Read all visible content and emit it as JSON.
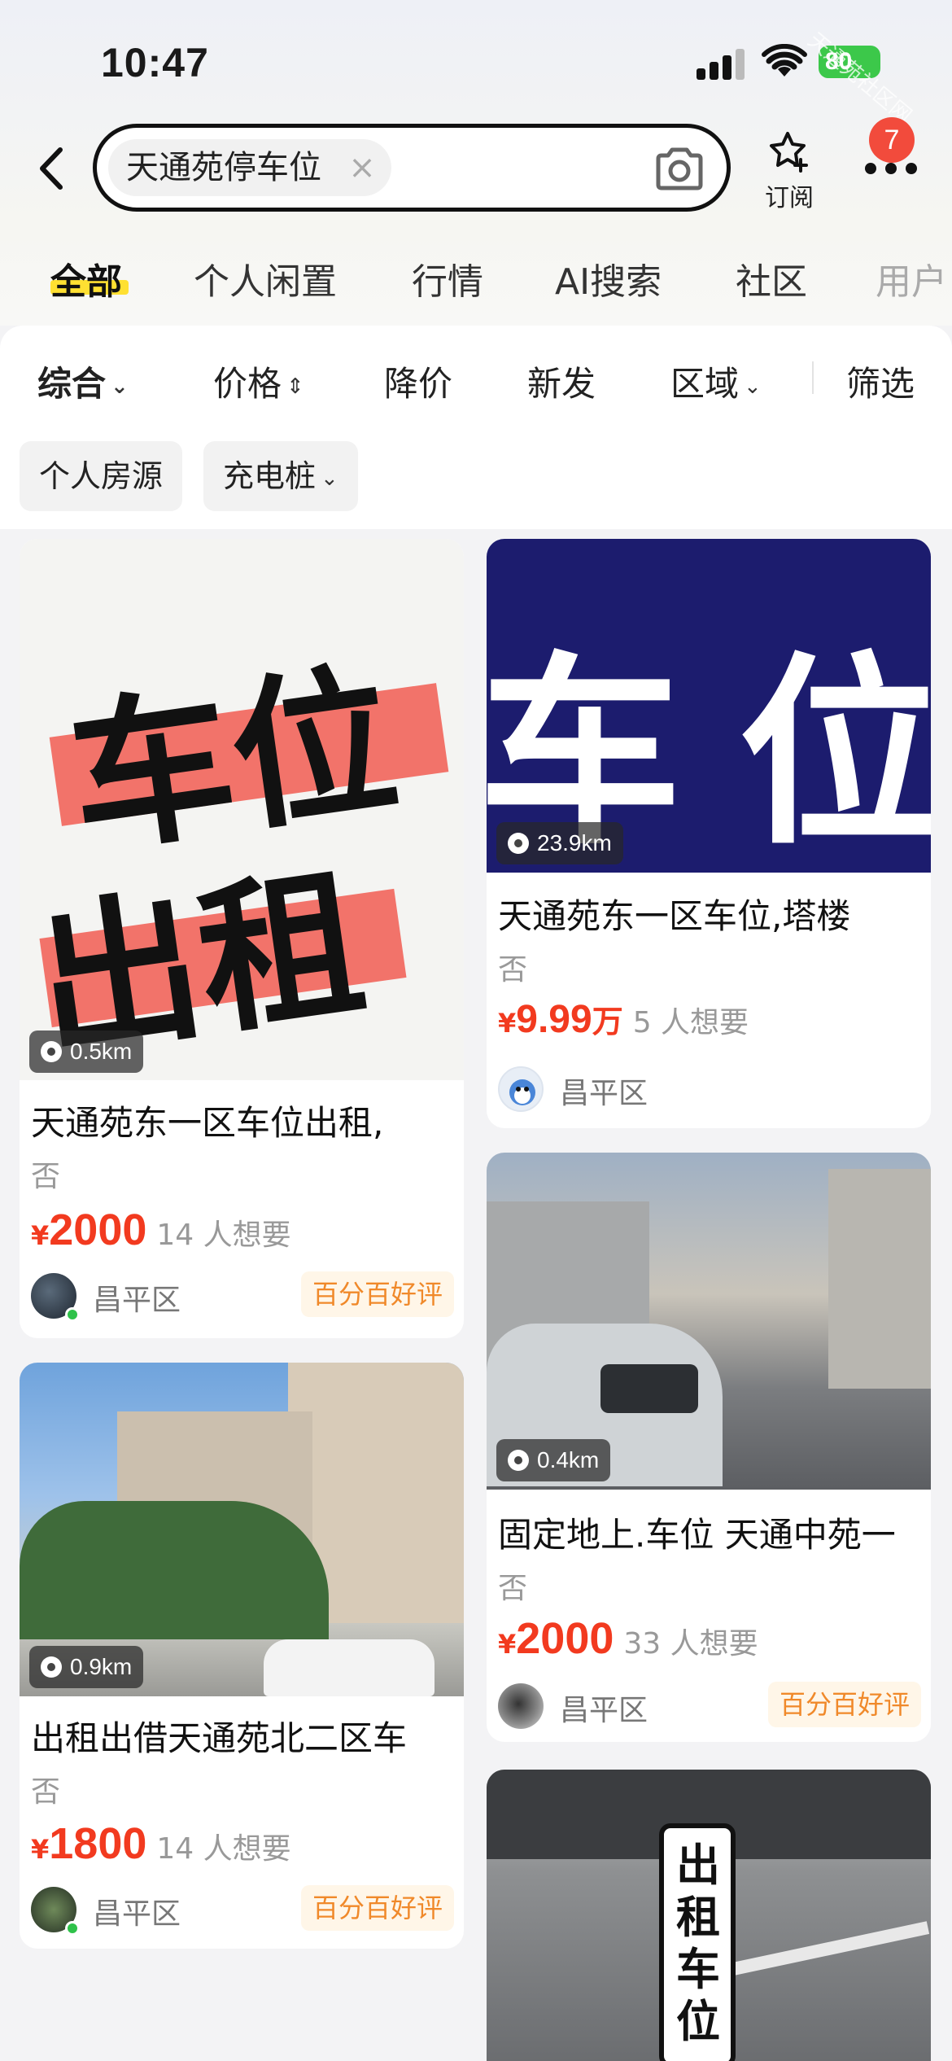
{
  "status_bar": {
    "time": "10:47",
    "battery": "80",
    "watermark": "天通苑社区网"
  },
  "search": {
    "query": "天通苑停车位",
    "clear_glyph": "×"
  },
  "header_actions": {
    "subscribe_label": "订阅",
    "notification_count": "7"
  },
  "tabs": [
    "全部",
    "个人闲置",
    "行情",
    "AI搜索",
    "社区",
    "用户"
  ],
  "filters": [
    "综合",
    "价格",
    "降价",
    "新发",
    "区域",
    "筛选"
  ],
  "tag_chips": [
    "个人房源",
    "充电桩"
  ],
  "cards": [
    {
      "image_text_1": "车位",
      "image_text_2": "出租",
      "distance": "0.5km",
      "title": "天通苑东一区车位出租,",
      "subtitle": "否",
      "currency": "¥",
      "price": "2000",
      "price_unit": "",
      "wants": "14 人想要",
      "location": "昌平区",
      "badge": "百分百好评"
    },
    {
      "image_text": "车位",
      "distance": "23.9km",
      "title": "天通苑东一区车位,塔楼",
      "subtitle": "否",
      "currency": "¥",
      "price": "9.99",
      "price_unit": "万",
      "wants": "5 人想要",
      "location": "昌平区",
      "badge": ""
    },
    {
      "distance": "0.4km",
      "title": "固定地上.车位 天通中苑一",
      "subtitle": "否",
      "currency": "¥",
      "price": "2000",
      "price_unit": "",
      "wants": "33 人想要",
      "location": "昌平区",
      "badge": "百分百好评"
    },
    {
      "distance": "0.9km",
      "title": "出租出借天通苑北二区车",
      "subtitle": "否",
      "currency": "¥",
      "price": "1800",
      "price_unit": "",
      "wants": "14 人想要",
      "location": "昌平区",
      "badge": "百分百好评"
    },
    {
      "sign_text": "出租车位"
    }
  ],
  "colors": {
    "price": "#f23a1f",
    "tab_underline": "#ffe032",
    "badge_bg": "#f24b3c",
    "good_badge_text": "#f0892a",
    "banner_blue": "#1c1c6e"
  }
}
